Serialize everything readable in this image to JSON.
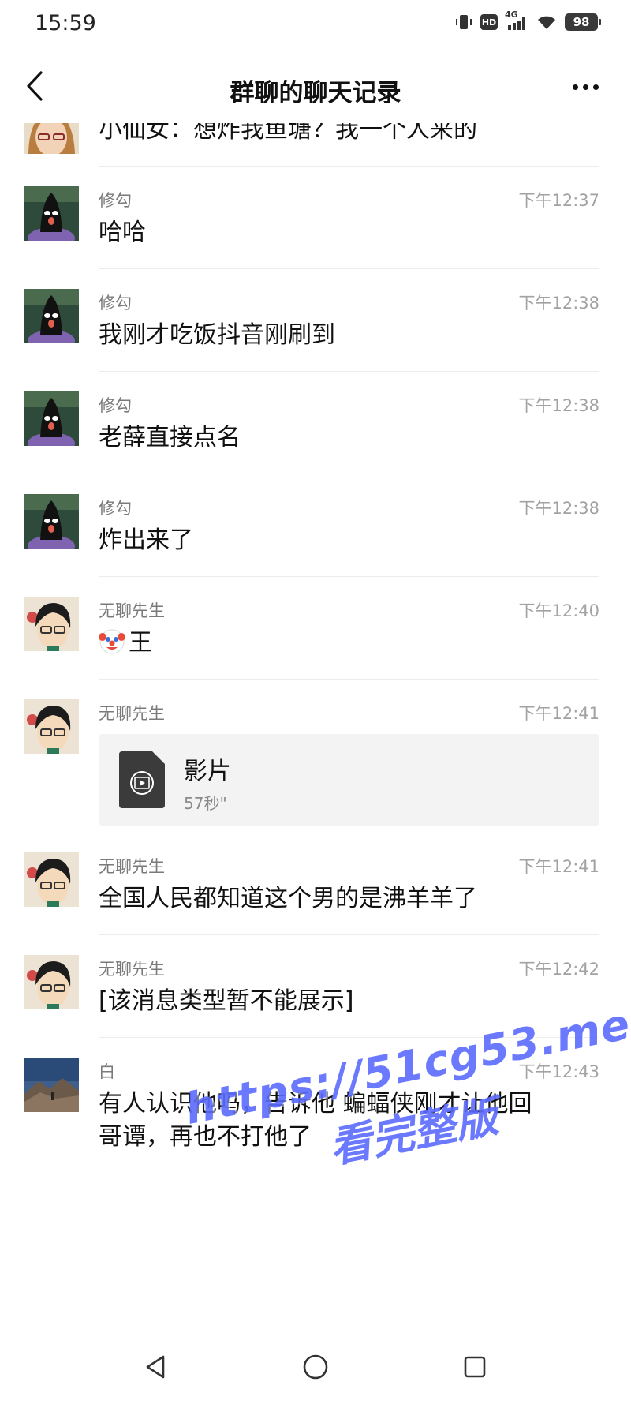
{
  "status_bar": {
    "time": "15:59",
    "network": "4G",
    "hd": "HD",
    "battery": "98"
  },
  "header": {
    "title": "群聊的聊天记录"
  },
  "messages": [
    {
      "sender": "",
      "time": "",
      "text": "小仙女：想炸我鱼塘？我一个人来的",
      "avatar": "girl-avatar"
    },
    {
      "sender": "修勾",
      "time": "下午12:37",
      "text": "哈哈",
      "avatar": "black-figure-avatar"
    },
    {
      "sender": "修勾",
      "time": "下午12:38",
      "text": "我刚才吃饭抖音刚刷到",
      "avatar": "black-figure-avatar"
    },
    {
      "sender": "修勾",
      "time": "下午12:38",
      "text": "老薛直接点名",
      "avatar": "black-figure-avatar"
    },
    {
      "sender": "修勾",
      "time": "下午12:38",
      "text": "炸出来了",
      "avatar": "black-figure-avatar"
    },
    {
      "sender": "无聊先生",
      "time": "下午12:40",
      "text": "王",
      "avatar": "cartoon-man-avatar"
    },
    {
      "sender": "无聊先生",
      "time": "下午12:41",
      "file_name": "影片",
      "file_duration": "57秒\"",
      "avatar": "cartoon-man-avatar"
    },
    {
      "sender": "无聊先生",
      "time": "下午12:41",
      "text": "全国人民都知道这个男的是沸羊羊了",
      "avatar": "cartoon-man-avatar"
    },
    {
      "sender": "无聊先生",
      "time": "下午12:42",
      "text": "[该消息类型暂不能展示]",
      "avatar": "cartoon-man-avatar"
    },
    {
      "sender": "白",
      "time": "下午12:43",
      "text_line1": "有人认识他吗，告诉他 蝙蝠侠刚才让他回",
      "text_line2": "哥谭，再也不打他了",
      "avatar": "mountain-photo-avatar"
    }
  ],
  "watermark": {
    "line1": "https://51cg53.me",
    "line2": "看完整版"
  },
  "nav": {
    "back": "back-triangle-icon",
    "home": "home-circle-icon",
    "recents": "recents-square-icon"
  },
  "colors": {
    "watermark": "#5b6bff",
    "divider": "#ececec",
    "time": "#a2a2a2",
    "sender": "#7a7a7a"
  }
}
